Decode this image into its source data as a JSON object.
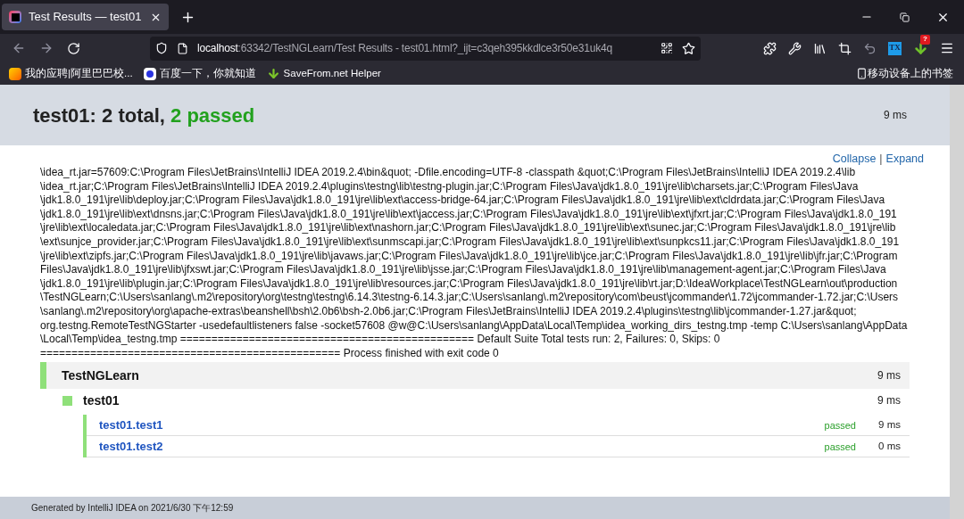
{
  "browser": {
    "tab": {
      "title": "Test Results — test01",
      "selected": true
    },
    "url": {
      "host": "localhost",
      "rest": ":63342/TestNGLearn/Test Results - test01.html?_ijt=c3qeh395kkdlce3r50e31uk4q"
    },
    "download_badge": "?",
    "tx_logo": "TX",
    "bookmarks": [
      {
        "label": "我的应聘|阿里巴巴校...",
        "kind": "orange"
      },
      {
        "label": "百度一下，你就知道",
        "kind": "paw"
      },
      {
        "label": "SaveFrom.net Helper",
        "kind": "download"
      }
    ],
    "mobile_bookmarks": "移动设备上的书签"
  },
  "header": {
    "title": "test01:",
    "total": "2 total,",
    "passed": "2 passed",
    "duration": "9 ms"
  },
  "links": {
    "collapse": "Collapse",
    "separator": "|",
    "expand": "Expand"
  },
  "log_lines": [
    "\\idea_rt.jar=57609:C:\\Program Files\\JetBrains\\IntelliJ IDEA 2019.2.4\\bin&quot; -Dfile.encoding=UTF-8 -classpath &quot;C:\\Program Files\\JetBrains\\IntelliJ IDEA 2019.2.4\\lib",
    "\\idea_rt.jar;C:\\Program Files\\JetBrains\\IntelliJ IDEA 2019.2.4\\plugins\\testng\\lib\\testng-plugin.jar;C:\\Program Files\\Java\\jdk1.8.0_191\\jre\\lib\\charsets.jar;C:\\Program Files\\Java",
    "\\jdk1.8.0_191\\jre\\lib\\deploy.jar;C:\\Program Files\\Java\\jdk1.8.0_191\\jre\\lib\\ext\\access-bridge-64.jar;C:\\Program Files\\Java\\jdk1.8.0_191\\jre\\lib\\ext\\cldrdata.jar;C:\\Program Files\\Java",
    "\\jdk1.8.0_191\\jre\\lib\\ext\\dnsns.jar;C:\\Program Files\\Java\\jdk1.8.0_191\\jre\\lib\\ext\\jaccess.jar;C:\\Program Files\\Java\\jdk1.8.0_191\\jre\\lib\\ext\\jfxrt.jar;C:\\Program Files\\Java\\jdk1.8.0_191",
    "\\jre\\lib\\ext\\localedata.jar;C:\\Program Files\\Java\\jdk1.8.0_191\\jre\\lib\\ext\\nashorn.jar;C:\\Program Files\\Java\\jdk1.8.0_191\\jre\\lib\\ext\\sunec.jar;C:\\Program Files\\Java\\jdk1.8.0_191\\jre\\lib",
    "\\ext\\sunjce_provider.jar;C:\\Program Files\\Java\\jdk1.8.0_191\\jre\\lib\\ext\\sunmscapi.jar;C:\\Program Files\\Java\\jdk1.8.0_191\\jre\\lib\\ext\\sunpkcs11.jar;C:\\Program Files\\Java\\jdk1.8.0_191",
    "\\jre\\lib\\ext\\zipfs.jar;C:\\Program Files\\Java\\jdk1.8.0_191\\jre\\lib\\javaws.jar;C:\\Program Files\\Java\\jdk1.8.0_191\\jre\\lib\\jce.jar;C:\\Program Files\\Java\\jdk1.8.0_191\\jre\\lib\\jfr.jar;C:\\Program",
    "Files\\Java\\jdk1.8.0_191\\jre\\lib\\jfxswt.jar;C:\\Program Files\\Java\\jdk1.8.0_191\\jre\\lib\\jsse.jar;C:\\Program Files\\Java\\jdk1.8.0_191\\jre\\lib\\management-agent.jar;C:\\Program Files\\Java",
    "\\jdk1.8.0_191\\jre\\lib\\plugin.jar;C:\\Program Files\\Java\\jdk1.8.0_191\\jre\\lib\\resources.jar;C:\\Program Files\\Java\\jdk1.8.0_191\\jre\\lib\\rt.jar;D:\\IdeaWorkplace\\TestNGLearn\\out\\production",
    "\\TestNGLearn;C:\\Users\\sanlang\\.m2\\repository\\org\\testng\\testng\\6.14.3\\testng-6.14.3.jar;C:\\Users\\sanlang\\.m2\\repository\\com\\beust\\jcommander\\1.72\\jcommander-1.72.jar;C:\\Users",
    "\\sanlang\\.m2\\repository\\org\\apache-extras\\beanshell\\bsh\\2.0b6\\bsh-2.0b6.jar;C:\\Program Files\\JetBrains\\IntelliJ IDEA 2019.2.4\\plugins\\testng\\lib\\jcommander-1.27.jar&quot;",
    "org.testng.RemoteTestNGStarter -usedefaultlisteners false -socket57608 @w@C:\\Users\\sanlang\\AppData\\Local\\Temp\\idea_working_dirs_testng.tmp -temp C:\\Users\\sanlang\\AppData",
    "\\Local\\Temp\\idea_testng.tmp =============================================== Default Suite Total tests run: 2, Failures: 0, Skips: 0",
    "================================================ Process finished with exit code 0"
  ],
  "suite": {
    "name": "TestNGLearn",
    "duration": "9 ms"
  },
  "class": {
    "name": "test01",
    "duration": "9 ms"
  },
  "tests": [
    {
      "name": "test01.test1",
      "status": "passed",
      "duration": "9 ms"
    },
    {
      "name": "test01.test2",
      "status": "passed",
      "duration": "0 ms"
    }
  ],
  "footer": "Generated by IntelliJ IDEA on 2021/6/30 下午12:59"
}
